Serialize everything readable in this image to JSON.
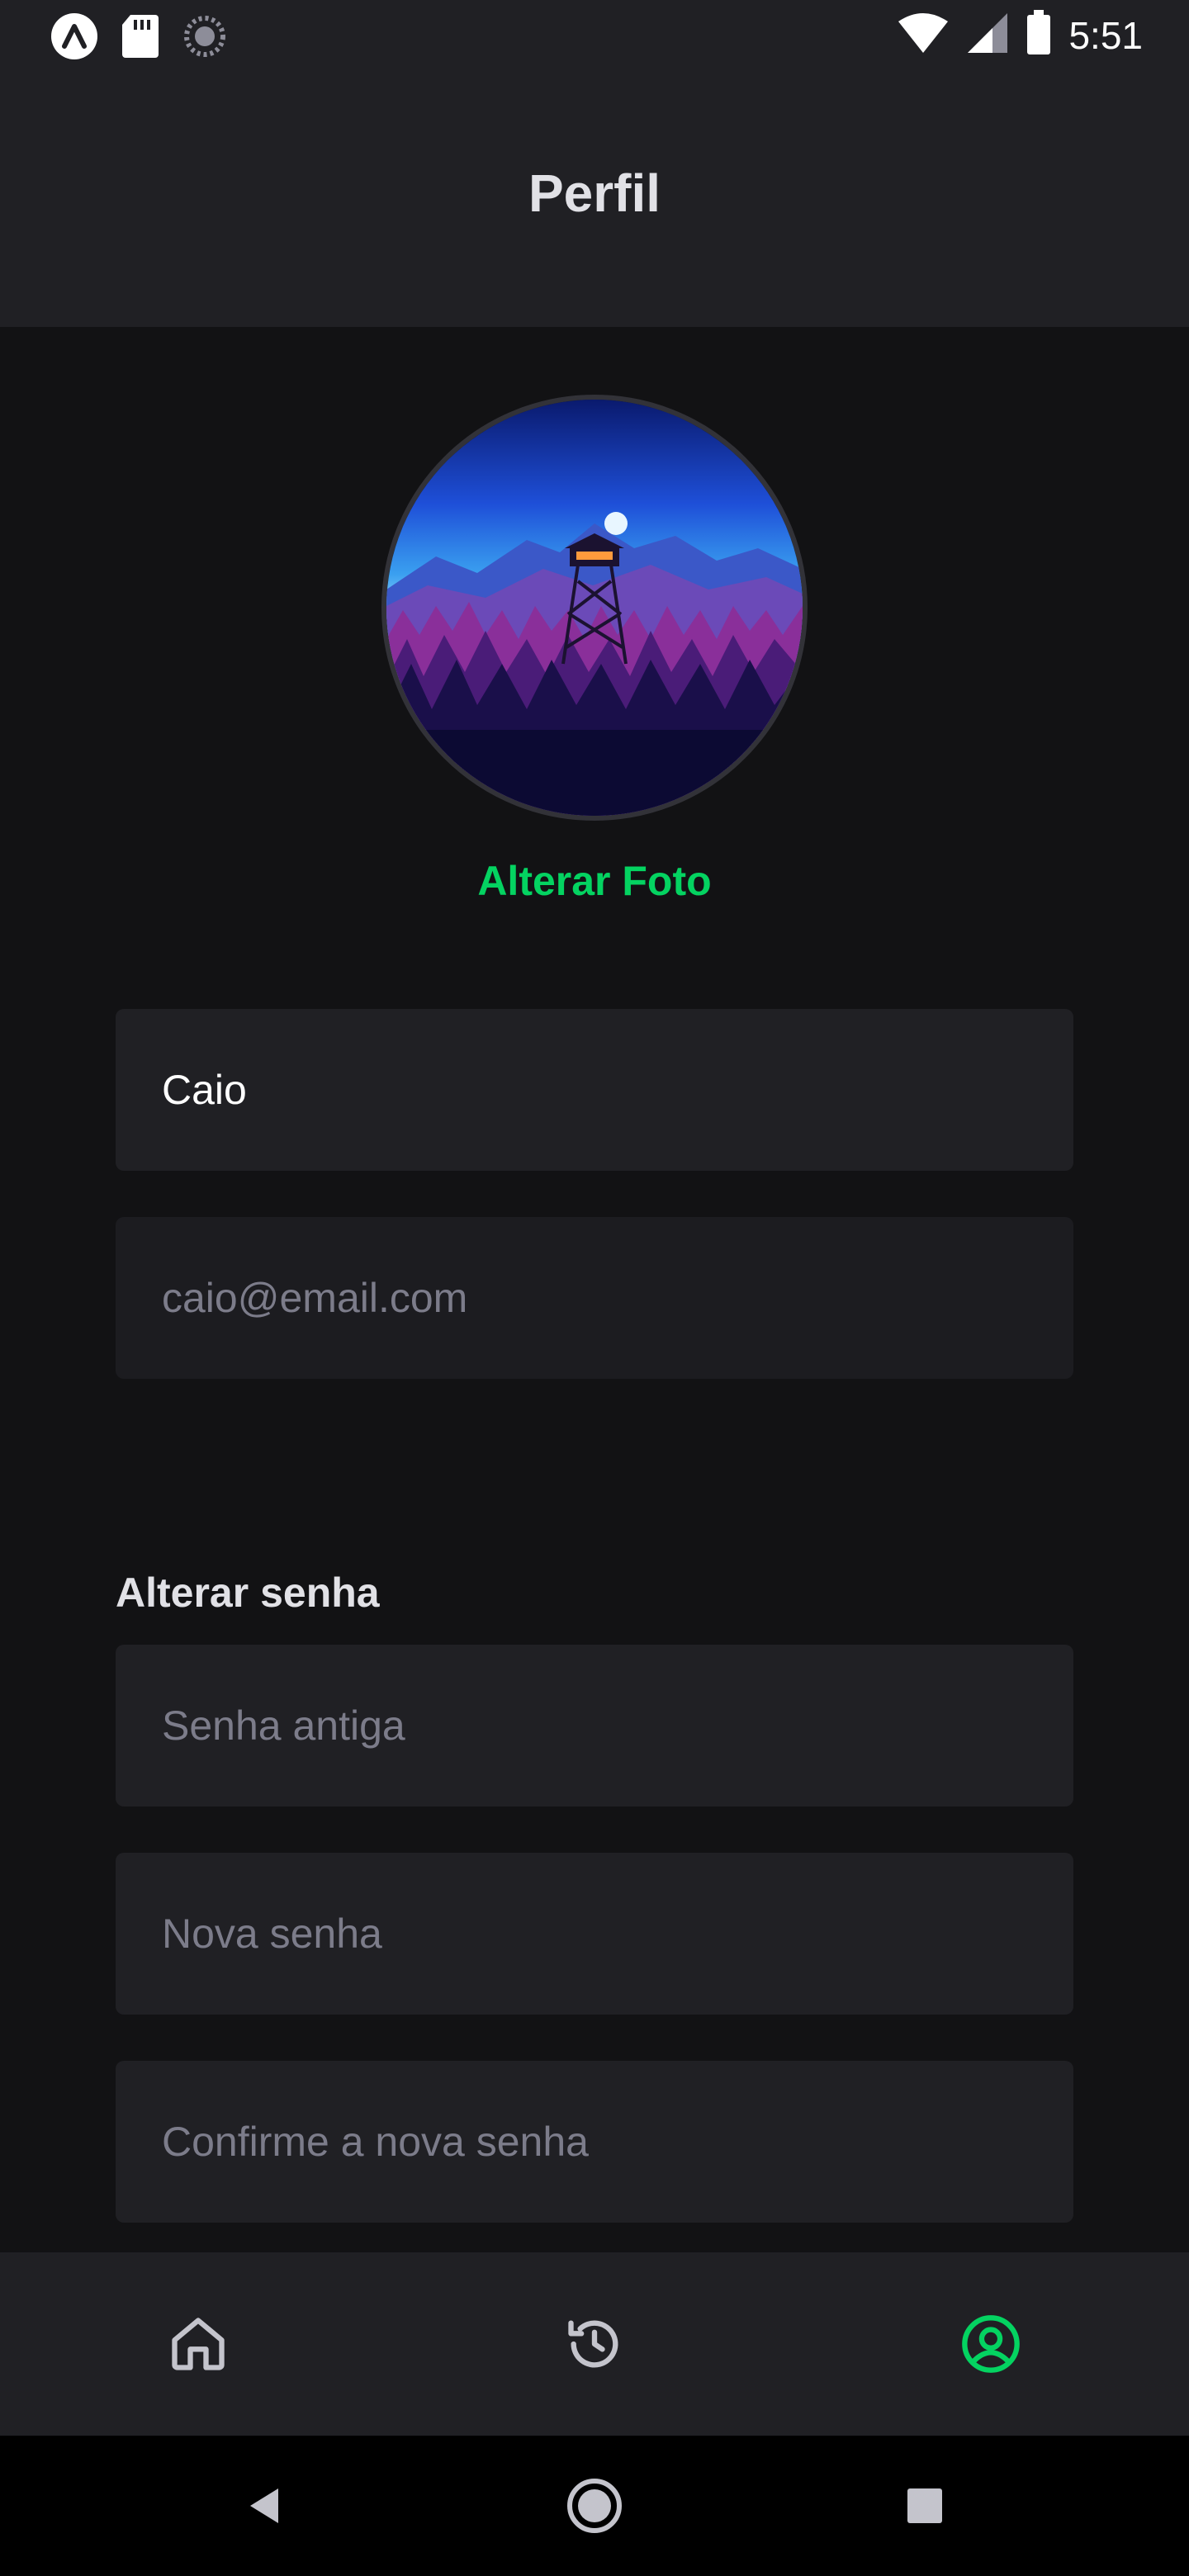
{
  "status_bar": {
    "time": "5:51",
    "icons": [
      "expo-icon",
      "sd-card-icon",
      "sync-icon",
      "wifi-icon",
      "signal-icon",
      "battery-icon"
    ]
  },
  "header": {
    "title": "Perfil"
  },
  "profile": {
    "change_photo_label": "Alterar Foto",
    "name_value": "Caio",
    "email_placeholder": "caio@email.com"
  },
  "password": {
    "section_label": "Alterar senha",
    "old_placeholder": "Senha antiga",
    "new_placeholder": "Nova senha",
    "confirm_placeholder": "Confirme a nova senha"
  },
  "tabs": [
    {
      "name": "home",
      "icon": "home-icon",
      "active": false
    },
    {
      "name": "history",
      "icon": "history-icon",
      "active": false
    },
    {
      "name": "profile",
      "icon": "user-circle-icon",
      "active": true
    }
  ],
  "colors": {
    "background": "#121214",
    "surface": "#202024",
    "accent": "#04d361",
    "text": "#e1e1e6",
    "placeholder": "#7c7c8a",
    "inactive_icon": "#c4c4cc"
  },
  "system_nav": [
    "back-icon",
    "home-circle-icon",
    "recents-icon"
  ]
}
